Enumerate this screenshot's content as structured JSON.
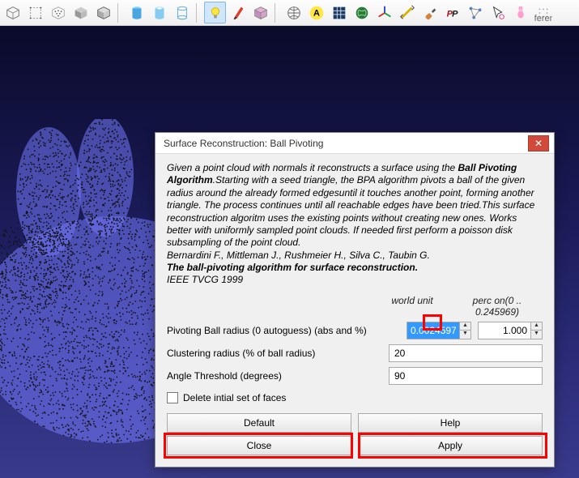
{
  "dialog": {
    "title": "Surface Reconstruction: Ball Pivoting",
    "desc_pre": "Given a point cloud with normals it reconstructs a surface using the ",
    "desc_alg": "Ball Pivoting Algorithm",
    "desc_post": ".Starting with a seed triangle, the BPA algorithm pivots a ball of the given radius around the already formed edgesuntil it touches another point, forming another triangle. The process continues until all reachable edges have been tried.This surface reconstruction algoritm uses the existing points without creating new ones. Works better with uniformly sampled point clouds. If needed first perform a poisson disk subsampling of the point cloud.",
    "desc_auth": "Bernardini F., Mittleman J., Rushmeier H., Silva C., Taubin G.",
    "desc_name": "The ball-pivoting algorithm for surface reconstruction.",
    "desc_pub": "IEEE TVCG 1999",
    "unit_world": "world unit",
    "unit_perc": "perc on(0 .. 0.245969)",
    "label_radius": "Pivoting Ball radius (0 autoguess) (abs and %)",
    "val_radius_abs": "0.0024597",
    "val_radius_perc": "1.000",
    "label_cluster": "Clustering radius (% of ball radius)",
    "val_cluster": "20",
    "label_angle": "Angle Threshold (degrees)",
    "val_angle": "90",
    "label_delete": "Delete intial set of faces",
    "btn_default": "Default",
    "btn_help": "Help",
    "btn_close": "Close",
    "btn_apply": "Apply"
  },
  "toolbar": {
    "icons": [
      "wireframe-cube",
      "bounding-box",
      "points-cube",
      "flat-cube",
      "smooth-cube",
      "cyl-solid",
      "cyl-hollow",
      "cyl-wireframe",
      "light-bulb",
      "red-marker",
      "selection-cube",
      "globe-icon",
      "yellow-a",
      "blue-grid",
      "green-mesh",
      "axes-icon",
      "measure-icon",
      "brush-icon",
      "pp-icon",
      "graph-icon",
      "pointer-arrow",
      "bunny-icon",
      "reference-icon"
    ]
  }
}
